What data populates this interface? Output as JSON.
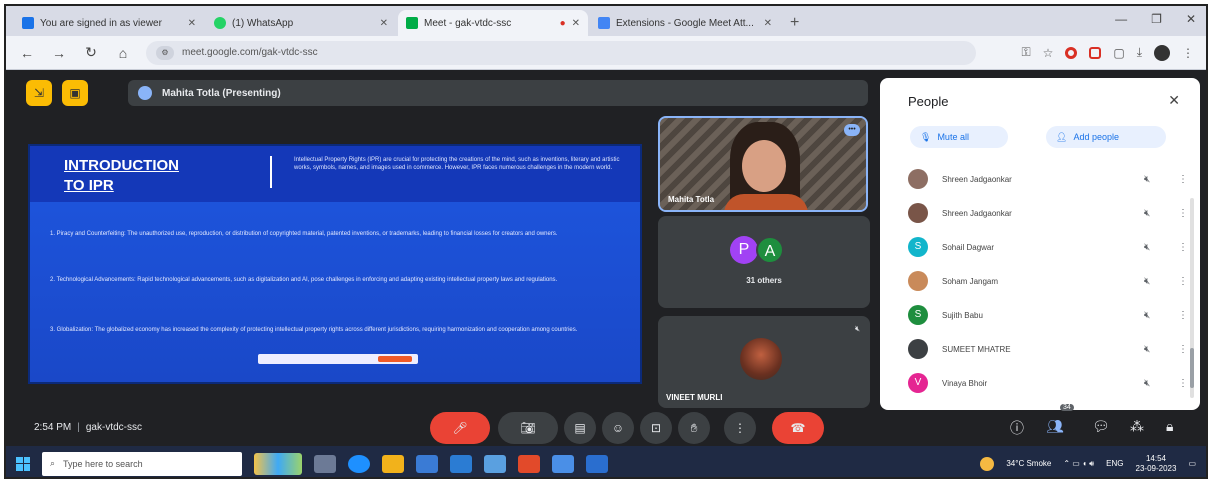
{
  "browser": {
    "tabs": [
      {
        "label": "You are signed in as viewer",
        "color": "#1a73e8",
        "active": false
      },
      {
        "label": "(1) WhatsApp",
        "color": "#25d366",
        "active": false
      },
      {
        "label": "Meet - gak-vtdc-ssc",
        "color": "#00ac47",
        "active": true
      },
      {
        "label": "Extensions - Google Meet Att...",
        "color": "#4285f4",
        "active": false
      }
    ],
    "address": "meet.google.com/gak-vtdc-ssc"
  },
  "meet": {
    "presenter_label": "Mahita Totla (Presenting)",
    "slide": {
      "title_line1": "INTRODUCTION",
      "title_line2": "TO IPR",
      "intro": "Intellectual Property Rights (IPR) are crucial for protecting the creations of the mind, such as inventions, literary and artistic works, symbols, names, and images used in commerce. However, IPR faces numerous challenges in the modern world.",
      "points": [
        "1. Piracy and Counterfeiting: The unauthorized use, reproduction, or distribution of copyrighted material, patented inventions, or trademarks, leading to financial losses for creators and owners.",
        "2. Technological Advancements: Rapid technological advancements, such as digitalization and AI, pose challenges in enforcing and adapting existing intellectual property laws and regulations.",
        "3. Globalization: The globalized economy has increased the complexity of protecting intellectual property rights across different jurisdictions, requiring harmonization and cooperation among countries."
      ]
    },
    "tiles": {
      "main_name": "Mahita Totla",
      "others_count": "31 others",
      "others_initials": [
        "P",
        "A"
      ],
      "vineet_name": "VINEET MURLI"
    },
    "people_panel": {
      "title": "People",
      "mute_all": "Mute all",
      "add_people": "Add people",
      "participants": [
        {
          "name": "Shreen Jadgaonkar",
          "color": "#8d6e63",
          "initial": ""
        },
        {
          "name": "Shreen Jadgaonkar",
          "color": "#795548",
          "initial": ""
        },
        {
          "name": "Sohail Dagwar",
          "color": "#12b5cb",
          "initial": "S"
        },
        {
          "name": "Soham Jangam",
          "color": "#c98a5a",
          "initial": ""
        },
        {
          "name": "Sujith Babu",
          "color": "#1e8e3e",
          "initial": "S"
        },
        {
          "name": "SUMEET MHATRE",
          "color": "#3c4043",
          "initial": ""
        },
        {
          "name": "Vinaya Bhoir",
          "color": "#e52592",
          "initial": "V"
        }
      ]
    },
    "bottom": {
      "time": "2:54 PM",
      "code": "gak-vtdc-ssc",
      "participant_count": "34"
    }
  },
  "taskbar": {
    "search_placeholder": "Type here to search",
    "weather": "34°C Smoke",
    "lang": "ENG",
    "time": "14:54",
    "date": "23-09-2023"
  }
}
